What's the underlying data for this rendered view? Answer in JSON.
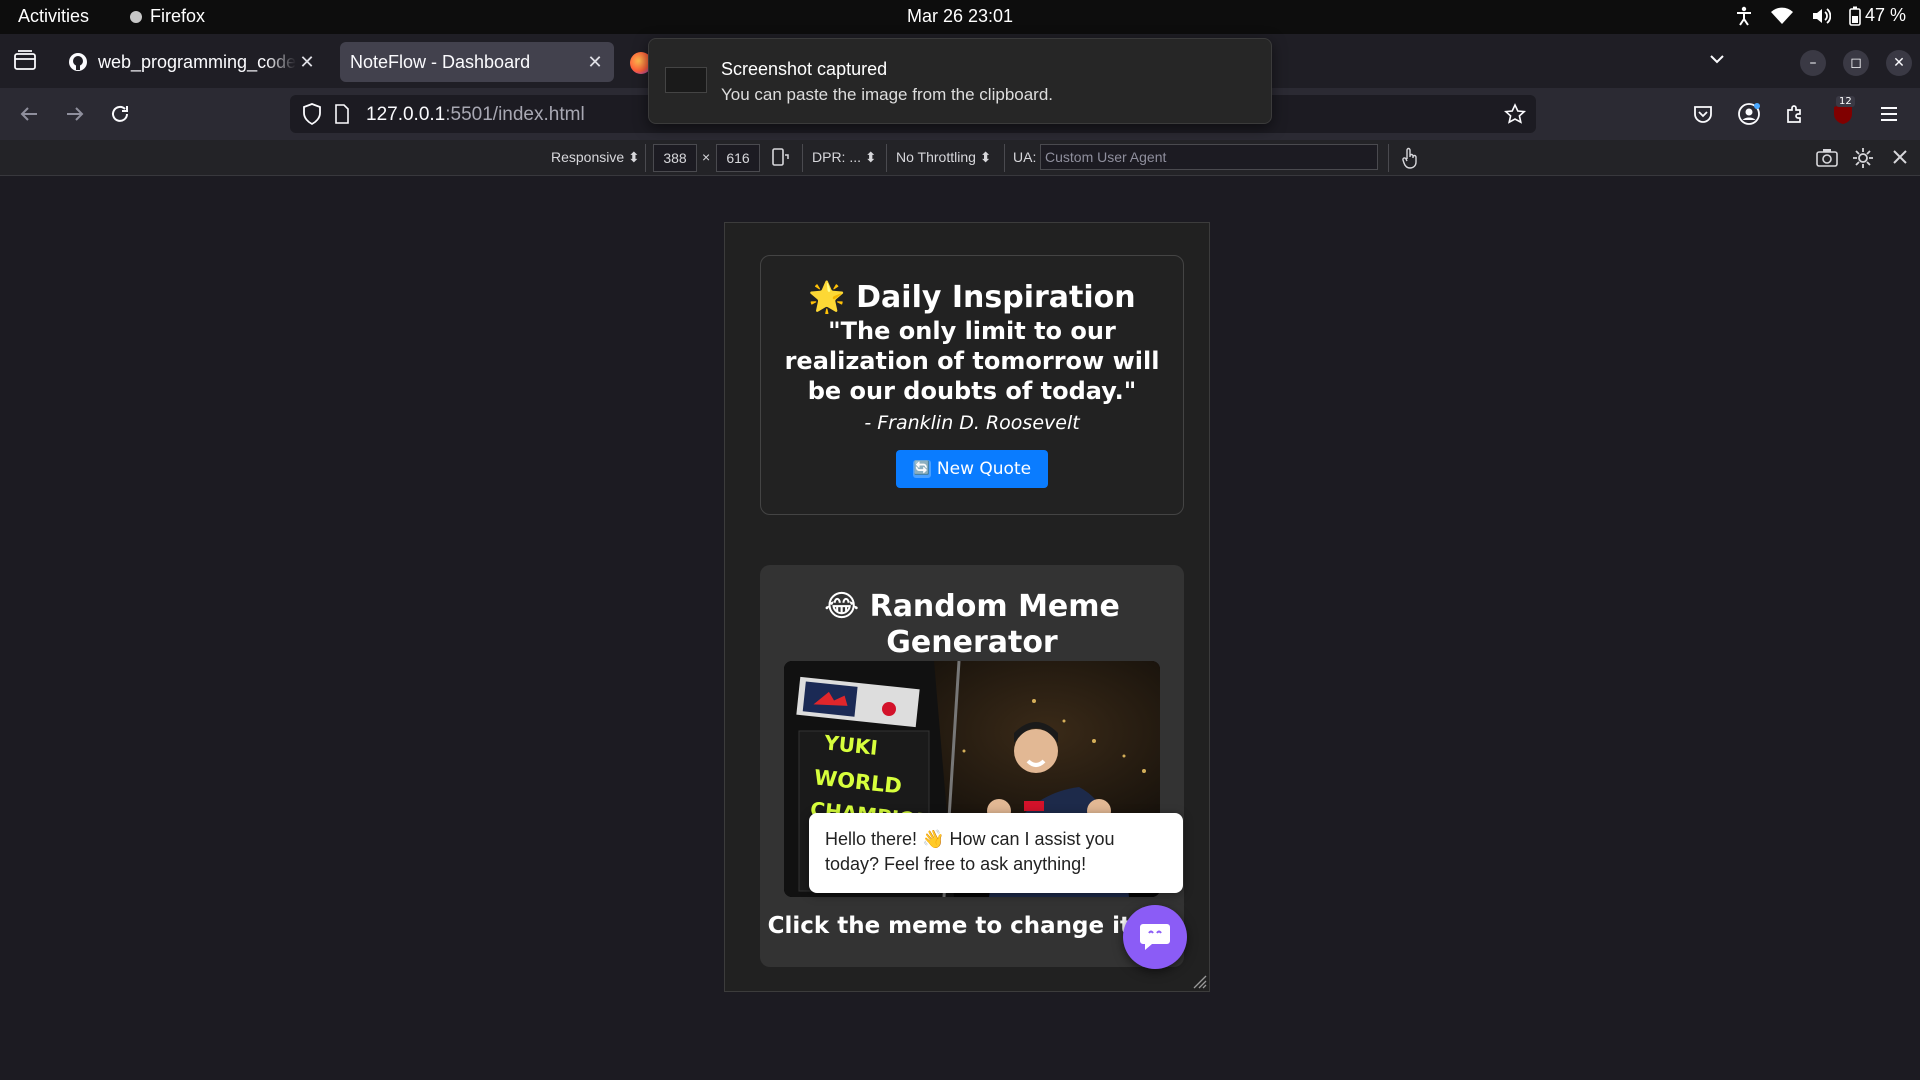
{
  "gnome": {
    "activities": "Activities",
    "app_name": "Firefox",
    "clock": "Mar 26  23:01",
    "battery": "47 %"
  },
  "tabs": [
    {
      "title": "web_programming_code",
      "icon": "github-icon"
    },
    {
      "title": "NoteFlow - Dashboard",
      "icon": "none"
    }
  ],
  "notification": {
    "title": "Screenshot captured",
    "body": "You can paste the image from the clipboard."
  },
  "url": {
    "host": "127.0.0.1",
    "rest": ":5501/index.html"
  },
  "extensions_badge": "12",
  "rdm": {
    "mode": "Responsive",
    "width": "388",
    "times": "×",
    "height": "616",
    "dpr": "DPR: ...",
    "throttling": "No Throttling",
    "ua_label": "UA:",
    "ua_placeholder": "Custom User Agent"
  },
  "quote_card": {
    "title": "🌟 Daily Inspiration",
    "quote": "\"The only limit to our realization of tomorrow will be our doubts of today.\"",
    "author": "- Franklin D. Roosevelt",
    "button_label": "New Quote",
    "button_icon": "🔄"
  },
  "meme_card": {
    "title": "😂 Random Meme Generator",
    "image_text": [
      "YUKI",
      "WORLD",
      "CHAMPION"
    ],
    "caption": "Click the meme to change it! 😂"
  },
  "chat": {
    "message": "Hello there! 👋 How can I assist you today? Feel free to ask anything!"
  },
  "colors": {
    "accent_button": "#0a7cff",
    "chat_button": "#8b5cf6",
    "page_bg": "#212121"
  }
}
